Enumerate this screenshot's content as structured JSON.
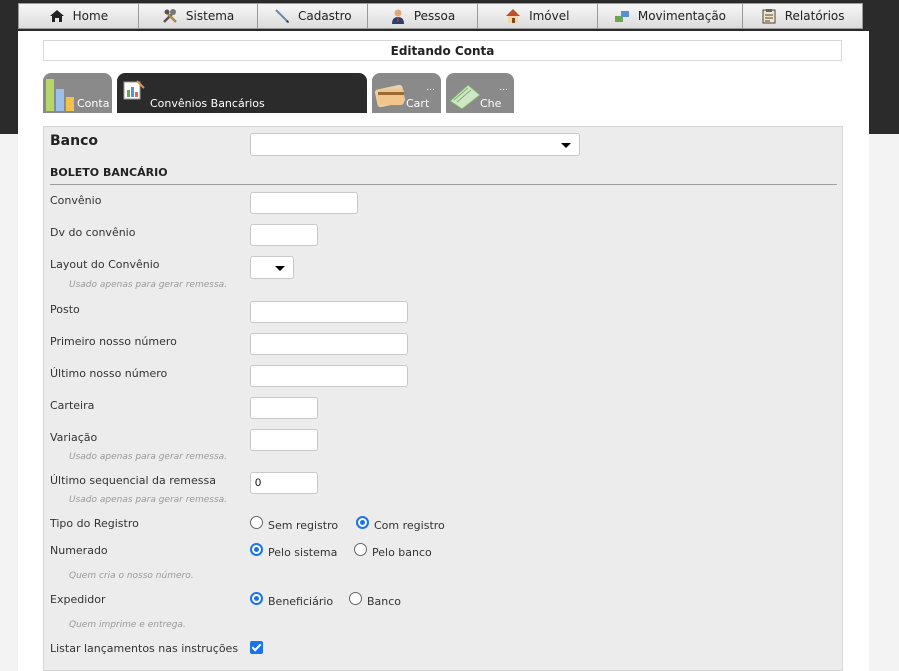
{
  "menu": [
    {
      "label": "Home",
      "icon": "home-icon"
    },
    {
      "label": "Sistema",
      "icon": "tools-icon"
    },
    {
      "label": "Cadastro",
      "icon": "pen-icon"
    },
    {
      "label": "Pessoa",
      "icon": "person-icon"
    },
    {
      "label": "Imóvel",
      "icon": "house-icon"
    },
    {
      "label": "Movimentação",
      "icon": "transfer-icon"
    },
    {
      "label": "Relatórios",
      "icon": "clipboard-icon"
    }
  ],
  "page_title": "Editando Conta",
  "tabs": [
    {
      "label": "Conta",
      "icon": "bar-chart-icon",
      "active": false
    },
    {
      "label": "Convênios Bancários",
      "icon": "report-chart-icon",
      "active": true
    },
    {
      "label": "Cart",
      "dots": "...",
      "icon": "credit-card-icon",
      "active": false
    },
    {
      "label": "Che",
      "dots": "...",
      "icon": "checkbook-icon",
      "active": false
    }
  ],
  "form": {
    "banco_label": "Banco",
    "banco_value": "",
    "section_title": "BOLETO BANCÁRIO",
    "convenio_label": "Convênio",
    "convenio_value": "",
    "dv_label": "Dv do convênio",
    "dv_value": "",
    "layout_label": "Layout do Convênio",
    "layout_value": "",
    "layout_hint": "Usado apenas para gerar remessa.",
    "posto_label": "Posto",
    "posto_value": "",
    "primeiro_label": "Primeiro nosso número",
    "primeiro_value": "",
    "ultimo_label": "Último nosso número",
    "ultimo_value": "",
    "carteira_label": "Carteira",
    "carteira_value": "",
    "variacao_label": "Variação",
    "variacao_value": "",
    "variacao_hint": "Usado apenas para gerar remessa.",
    "sequencial_label": "Último sequencial da remessa",
    "sequencial_value": "0",
    "sequencial_hint": "Usado apenas para gerar remessa.",
    "tipo_label": "Tipo do Registro",
    "tipo_options": [
      "Sem registro",
      "Com registro"
    ],
    "tipo_selected": "Com registro",
    "numerado_label": "Numerado",
    "numerado_options": [
      "Pelo sistema",
      "Pelo banco"
    ],
    "numerado_selected": "Pelo sistema",
    "numerado_hint": "Quem cria o nosso número.",
    "expedidor_label": "Expedidor",
    "expedidor_options": [
      "Beneficiário",
      "Banco"
    ],
    "expedidor_selected": "Beneficiário",
    "expedidor_hint": "Quem imprime e entrega.",
    "listar_label": "Listar lançamentos nas instruções",
    "listar_checked": true
  },
  "colors": {
    "header_band": "#2b2b2b",
    "active_tab": "#2b2b2b",
    "inactive_tab": "#8a8a8a",
    "radio_accent": "#1a73e8"
  }
}
